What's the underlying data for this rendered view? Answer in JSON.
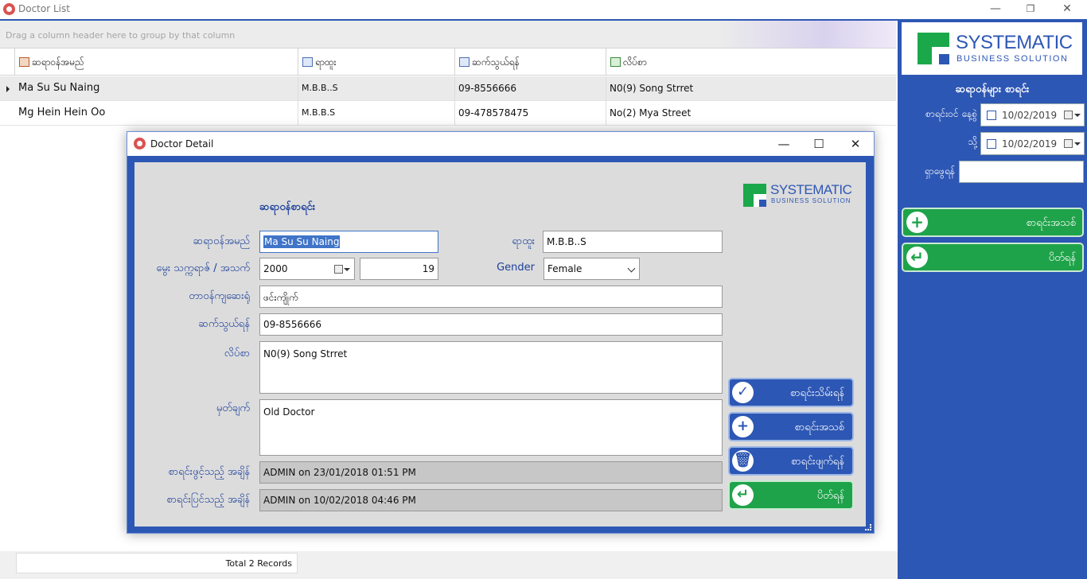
{
  "window": {
    "title": "Doctor List",
    "minimize": "—",
    "restore": "❐",
    "close": "✕"
  },
  "grid": {
    "group_hint": "Drag a column header here to group by that column",
    "columns": [
      {
        "label": "ဆရာဝန်အမည်",
        "icon": "doctor-icon"
      },
      {
        "label": "ရာထူး",
        "icon": "id-card-icon"
      },
      {
        "label": "ဆက်သွယ်ရန်",
        "icon": "mail-icon"
      },
      {
        "label": "လိပ်စာ",
        "icon": "address-book-icon"
      }
    ],
    "rows": [
      {
        "name": "Ma Su Su Naing",
        "position": "M.B.B..S",
        "phone": "09-8556666",
        "address": "N0(9) Song Strret"
      },
      {
        "name": "Mg Hein Hein Oo",
        "position": "M.B.B.S",
        "phone": "09-478578475",
        "address": "No(2) Mya Street"
      }
    ]
  },
  "status": {
    "total": "Total 2 Records"
  },
  "right_panel": {
    "logo": {
      "line1": "SYSTEMATIC",
      "line2": "BUSINESS SOLUTION"
    },
    "title": "ဆရာဝန်များ စာရင်း",
    "date_from_label": "စာရင်းဝင် နေ့စွဲ",
    "date_from": "10/02/2019",
    "date_to_label": "သို့",
    "date_to": "10/02/2019",
    "search_label": "ရှာဖွေရန်",
    "search_value": "",
    "new_label": "စာရင်းအသစ်",
    "close_label": "ပိတ်ရန်"
  },
  "dialog": {
    "title": "Doctor Detail",
    "minimize": "—",
    "maximize": "☐",
    "close": "✕",
    "heading": "ဆရာဝန်စာရင်း",
    "logo": {
      "line1": "SYSTEMATIC",
      "line2": "BUSINESS SOLUTION"
    },
    "fields": {
      "name_label": "ဆရာဝန်အမည်",
      "name_value": "Ma Su Su Naing",
      "position_label": "ရာထူး",
      "position_value": "M.B.B..S",
      "birth_label": "မွေး သက္ကရာဇ် / အသက်",
      "birth_year": "2000",
      "age": "19",
      "gender_label": "Gender",
      "gender_value": "Female",
      "duty_label": "တာဝန်ကျဆေးရုံ",
      "duty_value": "ဖင်းကျိုက်",
      "phone_label": "ဆက်သွယ်ရန်",
      "phone_value": "09-8556666",
      "address_label": "လိပ်စာ",
      "address_value": "N0(9) Song Strret",
      "remark_label": "မှတ်ချက်",
      "remark_value": "Old Doctor",
      "created_label": "စာရင်းဖွင့်သည့် အချိန်",
      "created_value": "ADMIN on 23/01/2018 01:51 PM",
      "modified_label": "စာရင်းပြင်သည့် အချိန်",
      "modified_value": "ADMIN on 10/02/2018 04:46 PM"
    },
    "buttons": {
      "save": "စာရင်းသိမ်းရန်",
      "new": "စာရင်းအသစ်",
      "delete": "စာရင်းဖျက်ရန်",
      "close": "ပိတ်ရန်"
    }
  },
  "colors": {
    "accent_blue": "#2d57b4",
    "accent_green": "#1fa34a"
  }
}
